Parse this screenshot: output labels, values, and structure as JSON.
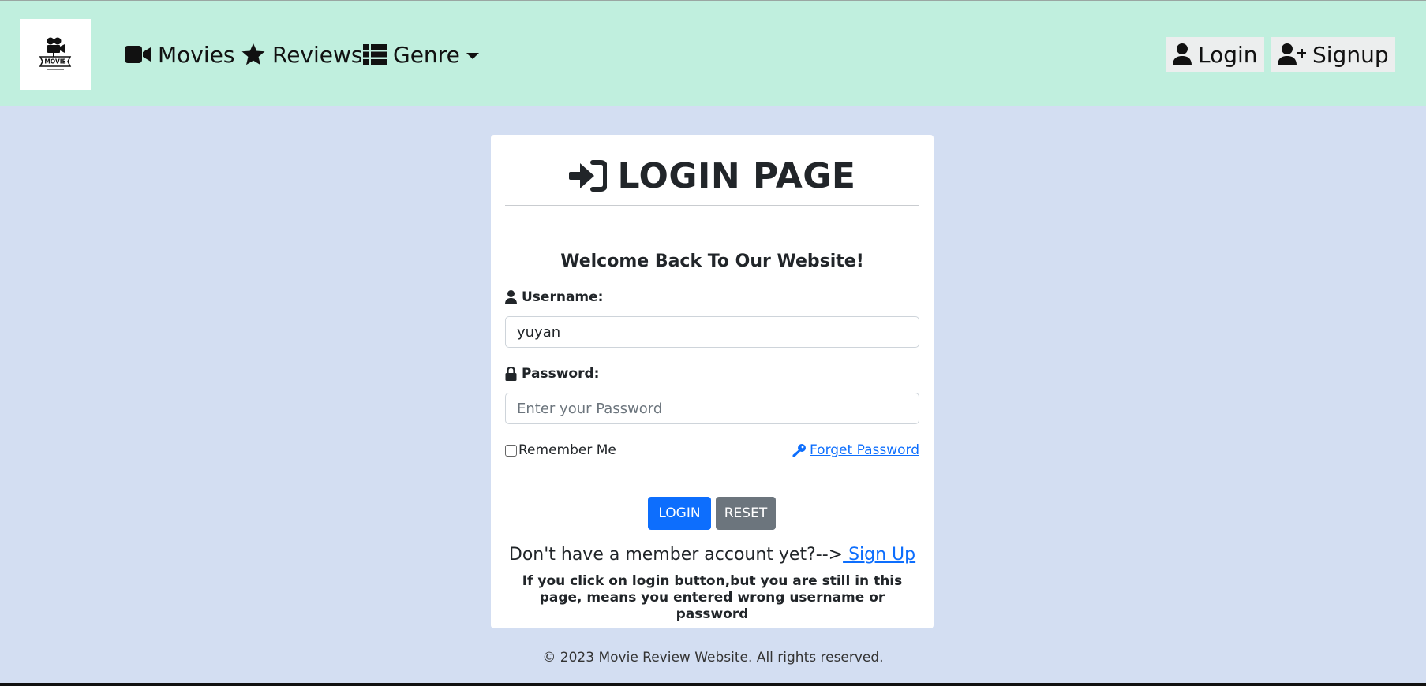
{
  "navbar": {
    "brand_logo_text": "MOVIE",
    "links": [
      {
        "label": "Movies",
        "icon": "video-camera-icon"
      },
      {
        "label": "Reviews",
        "icon": "star-icon"
      },
      {
        "label": "Genre",
        "icon": "list-icon"
      }
    ],
    "login_label": "Login",
    "signup_label": "Signup",
    "background": "#c0efde"
  },
  "login_card": {
    "title": "LOGIN PAGE",
    "welcome": "Welcome Back To Our Website!",
    "username_label": "Username:",
    "username_value": "yuyan",
    "password_label": "Password:",
    "password_placeholder": "Enter your Password",
    "remember_label": "Remember Me",
    "forget_label": " Forget Password",
    "login_button": "LOGIN",
    "reset_button": "RESET",
    "signup_prompt": "Don't have a member account yet?-->",
    "signup_link": " Sign Up",
    "note": "If you click on login button,but you are still in this page, means you entered wrong username or password"
  },
  "footer": {
    "text": "© 2023 Movie Review Website. All rights reserved."
  },
  "colors": {
    "page_background": "#d3def2",
    "primary": "#0d6efd",
    "secondary": "#6c757d"
  }
}
